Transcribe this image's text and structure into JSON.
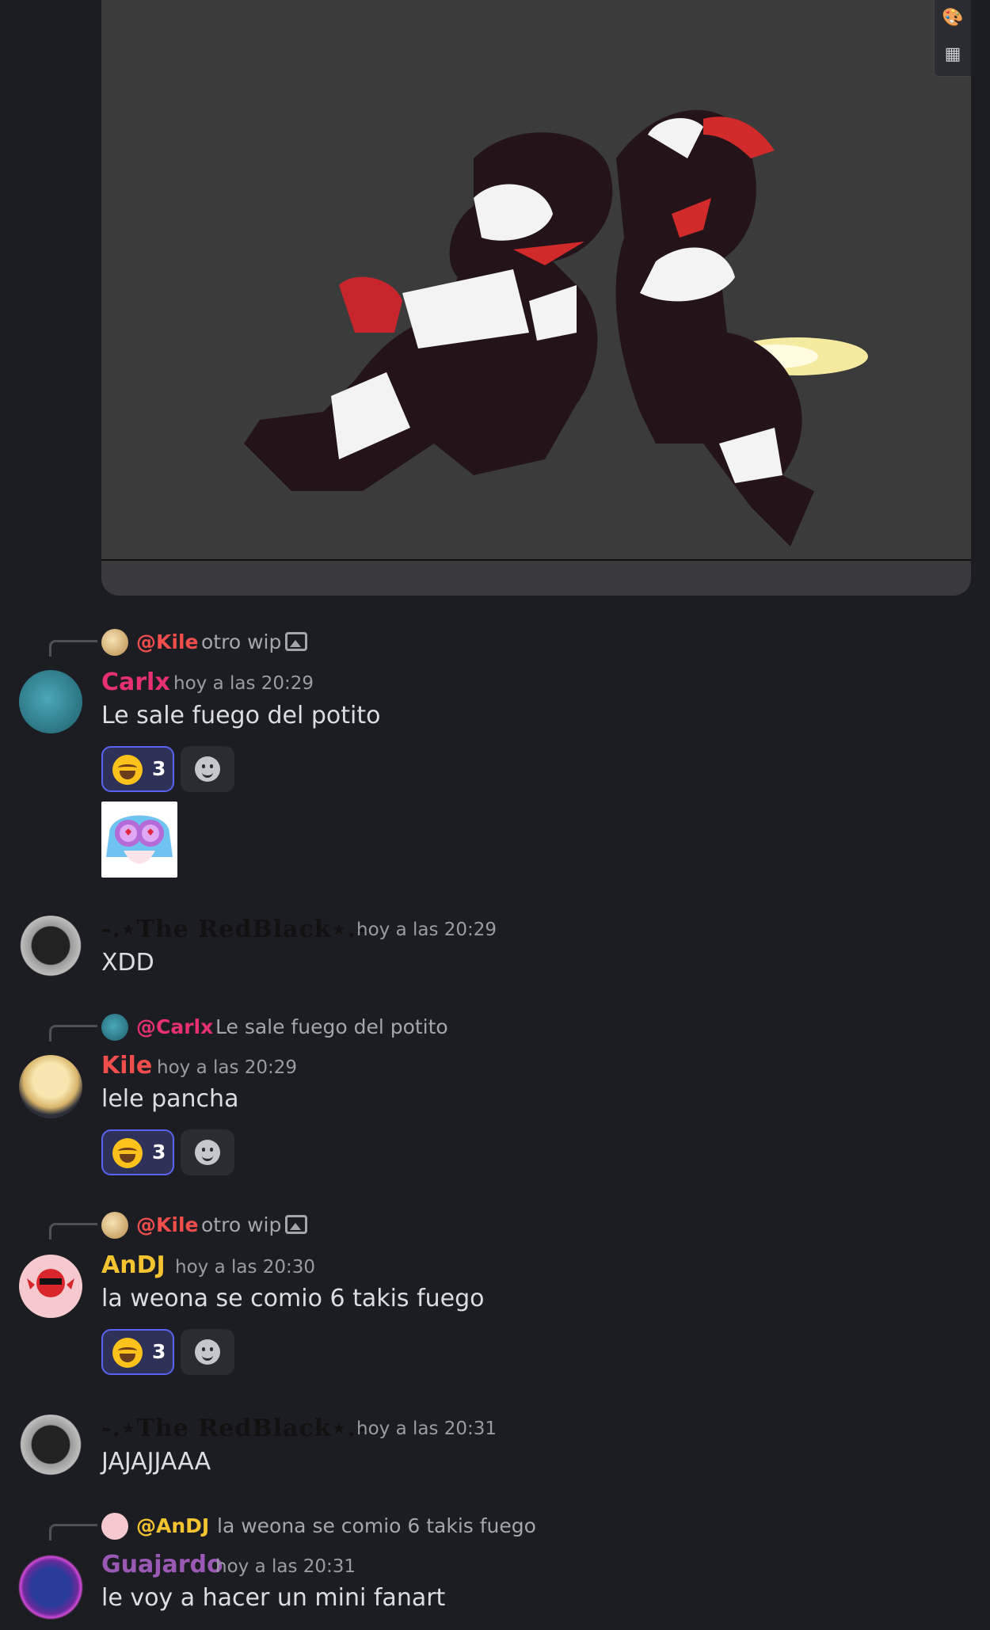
{
  "embed": {
    "tools": {
      "palette_icon": "palette-icon",
      "grid_icon": "grid-icon"
    }
  },
  "messages": [
    {
      "reply": {
        "name": "@Kile",
        "text": "otro wip",
        "color": "#f04d4d"
      },
      "author": "Carlx",
      "author_color": "#e6306f",
      "timestamp": "hoy a las 20:29",
      "content": "Le sale fuego del potito",
      "reaction_count": "3"
    },
    {
      "author": "-.⋆The RedBlack⋆.-",
      "timestamp": "hoy a las 20:29",
      "content": "XDD"
    },
    {
      "reply": {
        "name": "@Carlx",
        "text": "Le sale fuego del potito",
        "color": "#e6306f"
      },
      "author": "Kile",
      "author_color": "#f04d4d",
      "timestamp": "hoy a las 20:29",
      "content": "lele pancha",
      "reaction_count": "3"
    },
    {
      "reply": {
        "name": "@Kile",
        "text": "otro wip",
        "color": "#f04d4d"
      },
      "author": "AnDJ",
      "author_color": "#f4c430",
      "timestamp": "hoy a las 20:30",
      "content": "la weona se comio 6 takis fuego",
      "reaction_count": "3"
    },
    {
      "author": "-.⋆The RedBlack⋆.-",
      "timestamp": "hoy a las 20:31",
      "content": "JAJAJJAAA"
    },
    {
      "reply": {
        "name": "@AnDJ",
        "text": "la weona se comio 6 takis fuego",
        "color": "#f4c430"
      },
      "author": "Guajardo",
      "author_color": "#9b59b6",
      "timestamp": "hoy a las 20:31",
      "content": "le voy a hacer un mini fanart"
    }
  ]
}
